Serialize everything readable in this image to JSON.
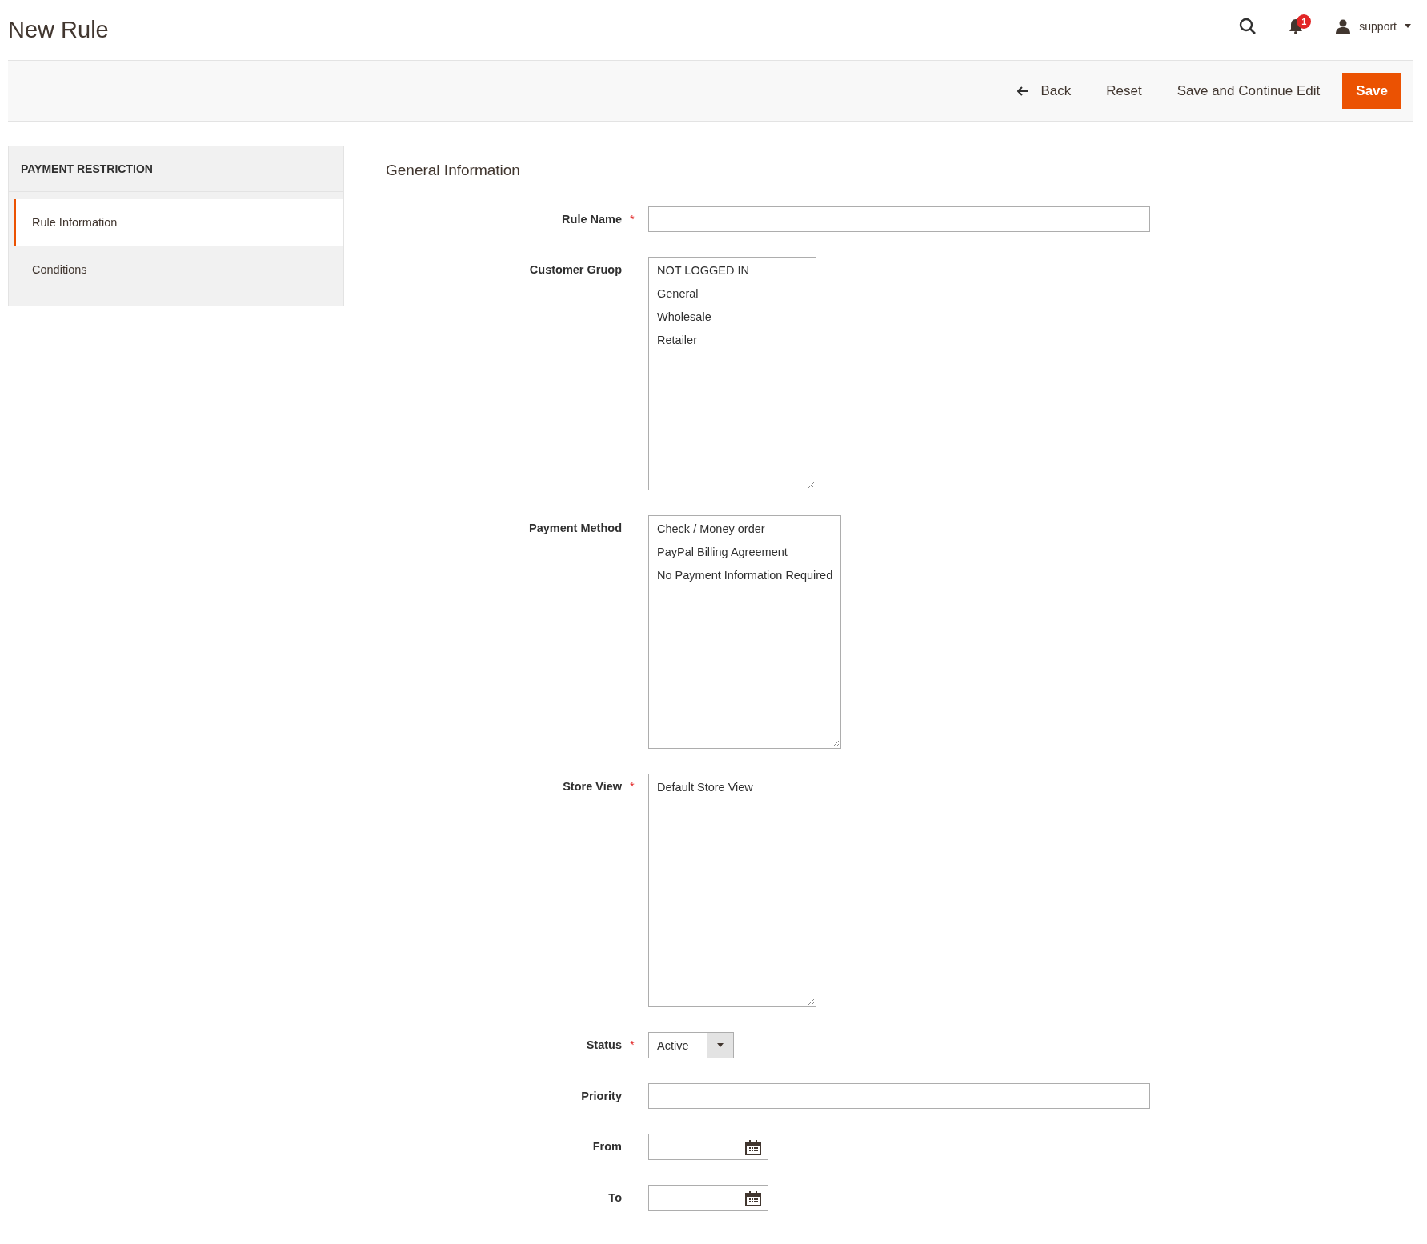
{
  "page_title": "New Rule",
  "header": {
    "user": "support",
    "notification_count": "1"
  },
  "actions": [
    {
      "label": "Back",
      "kind": "back"
    },
    {
      "label": "Reset",
      "kind": "plain"
    },
    {
      "label": "Save and Continue Edit",
      "kind": "plain"
    },
    {
      "label": "Save",
      "kind": "primary"
    }
  ],
  "sidebar": {
    "title": "PAYMENT RESTRICTION",
    "items": [
      {
        "label": "Rule Information",
        "selected": true
      },
      {
        "label": "Conditions",
        "selected": false
      }
    ]
  },
  "section_title": "General Information",
  "fields": [
    {
      "label": "Rule Name",
      "required_mark": "*",
      "kind": "text"
    },
    {
      "label": "Customer Gruop",
      "kind": "multiselect",
      "options": [
        {
          "label": "NOT LOGGED IN",
          "selected": false
        },
        {
          "label": "General",
          "selected": false
        },
        {
          "label": "Wholesale",
          "selected": false
        },
        {
          "label": "Retailer",
          "selected": false
        }
      ]
    },
    {
      "label": "Payment Method",
      "kind": "multiselect",
      "options": [
        {
          "label": "Check / Money order",
          "selected": false
        },
        {
          "label": "PayPal Billing Agreement",
          "selected": false
        },
        {
          "label": "No Payment Information Required",
          "selected": false
        }
      ]
    },
    {
      "label": "Store View",
      "required_mark": "*",
      "kind": "multiselect",
      "options": [
        {
          "label": "Default Store View",
          "selected": false
        }
      ]
    },
    {
      "label": "Status",
      "required_mark": "*",
      "kind": "select",
      "value": "Active"
    },
    {
      "label": "Priority",
      "kind": "text"
    },
    {
      "label": "From",
      "kind": "date"
    },
    {
      "label": "To",
      "kind": "date"
    }
  ]
}
